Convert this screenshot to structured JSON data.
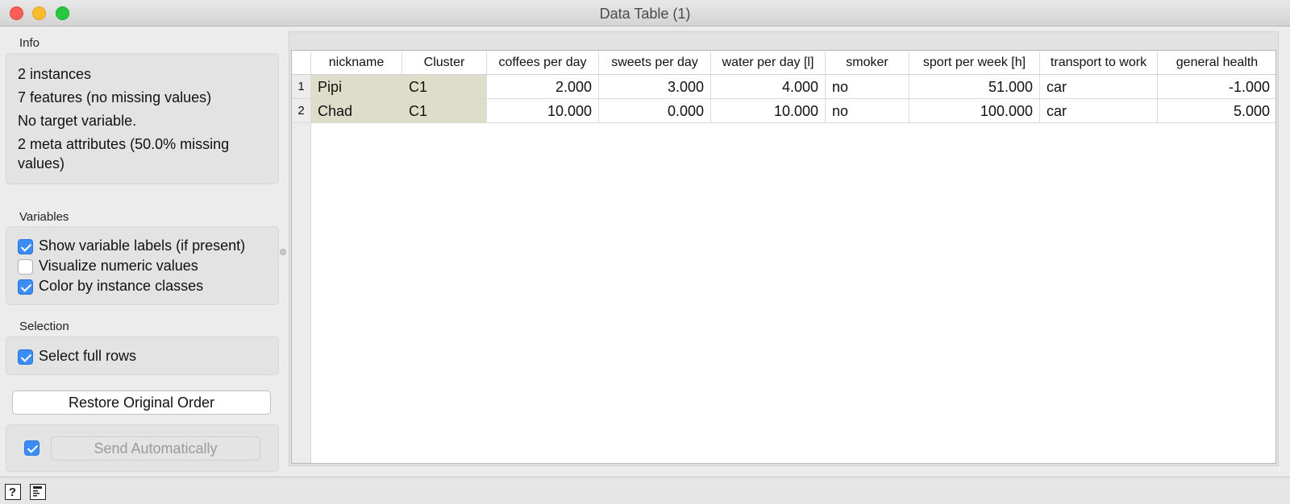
{
  "window": {
    "title": "Data Table (1)"
  },
  "info": {
    "label": "Info",
    "lines": [
      "2 instances",
      "7 features (no missing values)",
      "No target variable.",
      "2 meta attributes (50.0% missing",
      "values)"
    ]
  },
  "variables": {
    "label": "Variables",
    "options": [
      {
        "label": "Show variable labels (if present)",
        "checked": true
      },
      {
        "label": "Visualize numeric values",
        "checked": false
      },
      {
        "label": "Color by instance classes",
        "checked": true
      }
    ]
  },
  "selection": {
    "label": "Selection",
    "options": [
      {
        "label": "Select full rows",
        "checked": true
      }
    ]
  },
  "buttons": {
    "restore": "Restore Original Order",
    "send": "Send Automatically",
    "send_auto_checked": true
  },
  "table": {
    "columns": [
      "nickname",
      "Cluster",
      "coffees per day",
      "sweets per day",
      "water per day [l]",
      "smoker",
      "sport per week [h]",
      "transport to work",
      "general health"
    ],
    "rows": [
      {
        "num": "1",
        "cells": [
          "Pipi",
          "C1",
          "2.000",
          "3.000",
          "4.000",
          "no",
          "51.000",
          "car",
          "-1.000"
        ]
      },
      {
        "num": "2",
        "cells": [
          "Chad",
          "C1",
          "10.000",
          "0.000",
          "10.000",
          "no",
          "100.000",
          "car",
          "5.000"
        ]
      }
    ]
  },
  "statusbar": {
    "icons": [
      "help-icon",
      "report-icon"
    ]
  },
  "colors": {
    "meta_cell": "#deddc9",
    "checkbox_on": "#3b8cf5"
  }
}
